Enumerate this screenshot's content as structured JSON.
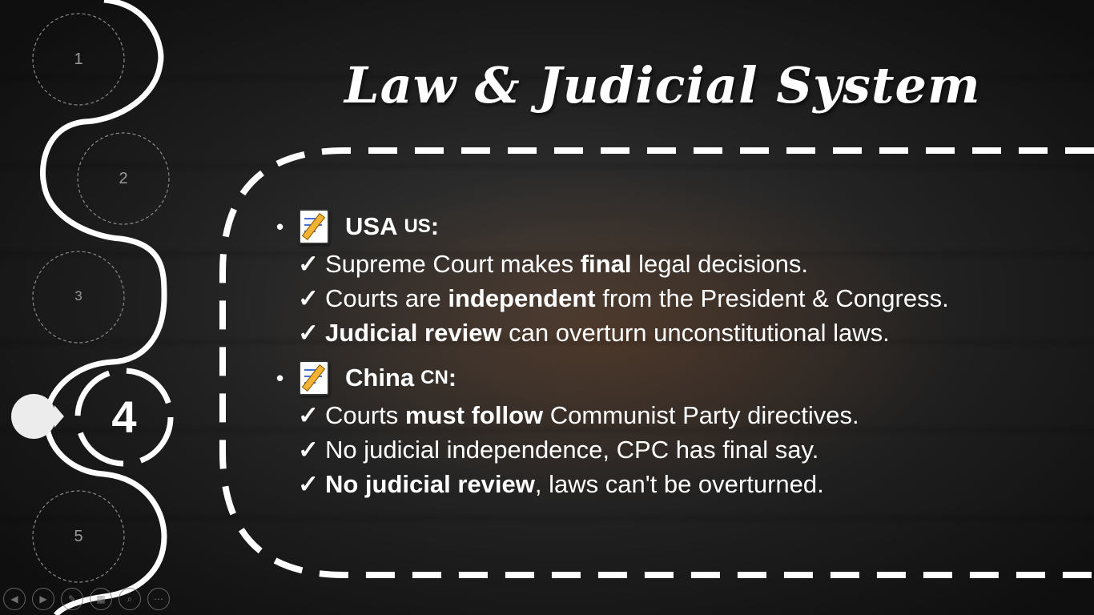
{
  "slide": {
    "title": "Law & Judicial System",
    "navigation": {
      "numbers": [
        "1",
        "2",
        "3",
        "4",
        "5"
      ],
      "active_number": "4"
    },
    "sections": [
      {
        "country": "USA",
        "code": "US",
        "points": [
          {
            "before": "Supreme Court makes ",
            "bold": "final",
            "after": " legal decisions."
          },
          {
            "before": "Courts are ",
            "bold": "independent",
            "after": " from the President & Congress."
          },
          {
            "before": "",
            "bold": "Judicial review",
            "after": " can overturn unconstitutional laws."
          }
        ]
      },
      {
        "country": "China",
        "code": "CN",
        "points": [
          {
            "before": "Courts ",
            "bold": "must follow",
            "after": " Communist Party directives."
          },
          {
            "before": "No judicial independence, CPC has final say.",
            "bold": "",
            "after": ""
          },
          {
            "before": "",
            "bold": "No judicial review",
            "after": ", laws can't be overturned."
          }
        ]
      }
    ]
  },
  "symbols": {
    "bullet": "•",
    "check": "✓",
    "colon": ":"
  },
  "icons": {
    "section_icon": "memo-icon",
    "controls": [
      "previous-icon",
      "next-icon",
      "pen-icon",
      "slides-icon",
      "zoom-icon",
      "more-options-icon"
    ]
  },
  "colors": {
    "text": "#ffffff",
    "path_stroke": "#ffffff",
    "glow": "#8a4a1a"
  }
}
